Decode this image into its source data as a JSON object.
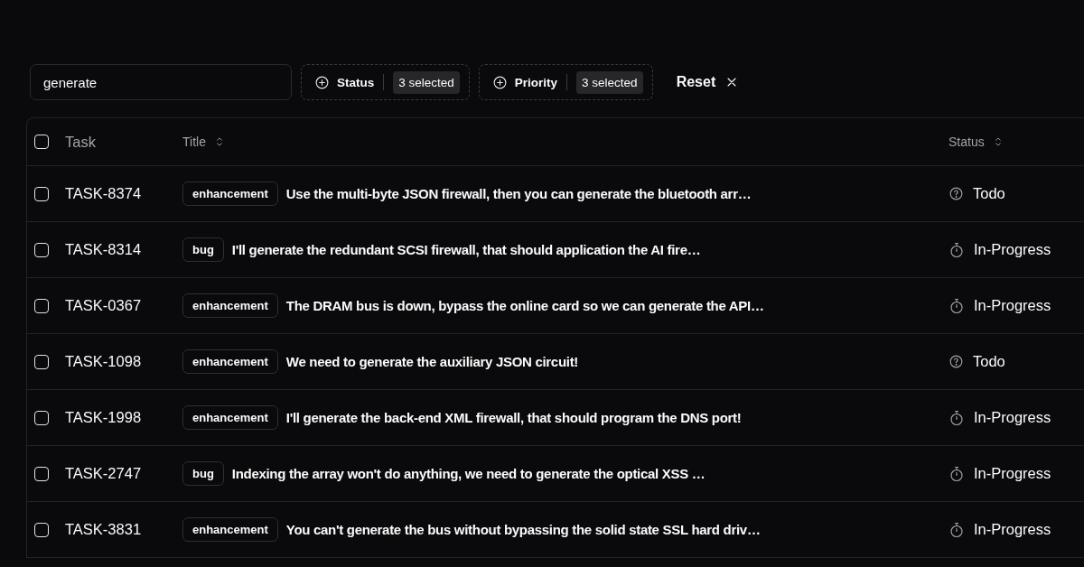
{
  "search": {
    "value": "generate"
  },
  "filters": [
    {
      "label": "Status",
      "badge": "3 selected"
    },
    {
      "label": "Priority",
      "badge": "3 selected"
    }
  ],
  "reset": {
    "label": "Reset"
  },
  "table": {
    "select_all": {
      "checked": false
    },
    "columns": [
      {
        "label": "Task",
        "sortable": false
      },
      {
        "label": "Title",
        "sortable": true
      },
      {
        "label": "Status",
        "sortable": true
      }
    ],
    "rows": [
      {
        "checked": false,
        "task": "TASK-8374",
        "label": "enhancement",
        "title": "Use the multi-byte JSON firewall, then you can generate the bluetooth arr…",
        "status": {
          "kind": "todo",
          "text": "Todo"
        }
      },
      {
        "checked": false,
        "task": "TASK-8314",
        "label": "bug",
        "title": "I'll generate the redundant SCSI firewall, that should application the AI fire…",
        "status": {
          "kind": "in-progress",
          "text": "In-Progress"
        }
      },
      {
        "checked": false,
        "task": "TASK-0367",
        "label": "enhancement",
        "title": "The DRAM bus is down, bypass the online card so we can generate the API…",
        "status": {
          "kind": "in-progress",
          "text": "In-Progress"
        }
      },
      {
        "checked": false,
        "task": "TASK-1098",
        "label": "enhancement",
        "title": "We need to generate the auxiliary JSON circuit!",
        "status": {
          "kind": "todo",
          "text": "Todo"
        }
      },
      {
        "checked": false,
        "task": "TASK-1998",
        "label": "enhancement",
        "title": "I'll generate the back-end XML firewall, that should program the DNS port!",
        "status": {
          "kind": "in-progress",
          "text": "In-Progress"
        }
      },
      {
        "checked": false,
        "task": "TASK-2747",
        "label": "bug",
        "title": "Indexing the array won't do anything, we need to generate the optical XSS …",
        "status": {
          "kind": "in-progress",
          "text": "In-Progress"
        }
      },
      {
        "checked": false,
        "task": "TASK-3831",
        "label": "enhancement",
        "title": "You can't generate the bus without bypassing the solid state SSL hard driv…",
        "status": {
          "kind": "in-progress",
          "text": "In-Progress"
        }
      }
    ]
  }
}
